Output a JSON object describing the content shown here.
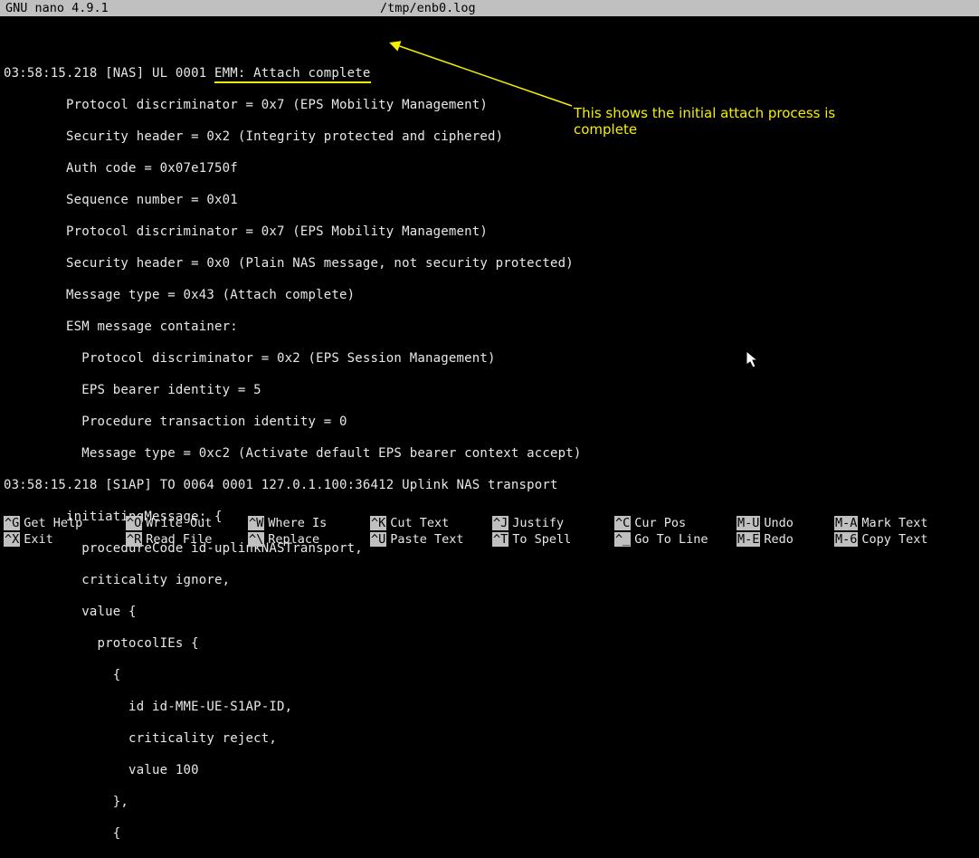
{
  "titlebar": {
    "app": "  GNU nano 4.9.1",
    "file": "/tmp/enb0.log"
  },
  "log": {
    "l0_pre": "03:58:15.218 [NAS] UL 0001 ",
    "l0_u": "EMM: Attach complete",
    "l1": "        Protocol discriminator = 0x7 (EPS Mobility Management)",
    "l2": "        Security header = 0x2 (Integrity protected and ciphered)",
    "l3": "        Auth code = 0x07e1750f",
    "l4": "        Sequence number = 0x01",
    "l5": "        Protocol discriminator = 0x7 (EPS Mobility Management)",
    "l6": "        Security header = 0x0 (Plain NAS message, not security protected)",
    "l7": "        Message type = 0x43 (Attach complete)",
    "l8": "        ESM message container:",
    "l9": "          Protocol discriminator = 0x2 (EPS Session Management)",
    "l10": "          EPS bearer identity = 5",
    "l11": "          Procedure transaction identity = 0",
    "l12": "          Message type = 0xc2 (Activate default EPS bearer context accept)",
    "l13": "03:58:15.218 [S1AP] TO 0064 0001 127.0.1.100:36412 Uplink NAS transport",
    "l14": "        initiatingMessage: {",
    "l15": "          procedureCode id-uplinkNASTransport,",
    "l16": "          criticality ignore,",
    "l17": "          value {",
    "l18": "            protocolIEs {",
    "l19": "              {",
    "l20": "                id id-MME-UE-S1AP-ID,",
    "l21": "                criticality reject,",
    "l22": "                value 100",
    "l23": "              },",
    "l24": "              {"
  },
  "annotation": {
    "line1": "This shows the initial attach process is",
    "line2": "complete"
  },
  "shortcuts": {
    "row1": [
      {
        "key": "^G",
        "desc": "Get Help"
      },
      {
        "key": "^O",
        "desc": "Write Out"
      },
      {
        "key": "^W",
        "desc": "Where Is"
      },
      {
        "key": "^K",
        "desc": "Cut Text"
      },
      {
        "key": "^J",
        "desc": "Justify"
      },
      {
        "key": "^C",
        "desc": "Cur Pos"
      },
      {
        "key": "M-U",
        "desc": "Undo"
      },
      {
        "key": "M-A",
        "desc": "Mark Text"
      }
    ],
    "row2": [
      {
        "key": "^X",
        "desc": "Exit"
      },
      {
        "key": "^R",
        "desc": "Read File"
      },
      {
        "key": "^\\",
        "desc": "Replace"
      },
      {
        "key": "^U",
        "desc": "Paste Text"
      },
      {
        "key": "^T",
        "desc": "To Spell"
      },
      {
        "key": "^_",
        "desc": "Go To Line"
      },
      {
        "key": "M-E",
        "desc": "Redo"
      },
      {
        "key": "M-6",
        "desc": "Copy Text"
      }
    ]
  }
}
